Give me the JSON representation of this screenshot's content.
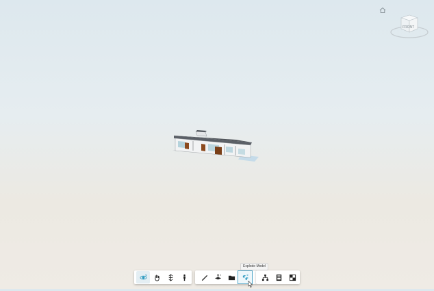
{
  "viewer": {
    "home_icon": "home-icon",
    "viewcube_label": "FRONT"
  },
  "tooltip": {
    "text": "Explode Model"
  },
  "toolbar": {
    "groups": [
      {
        "tools": [
          {
            "name": "orbit",
            "icon": "orbit-icon",
            "active": true
          },
          {
            "name": "pan",
            "icon": "hand-icon"
          },
          {
            "name": "zoom",
            "icon": "zoom-arrows-icon"
          },
          {
            "name": "first-person",
            "icon": "person-icon"
          }
        ]
      },
      {
        "tools": [
          {
            "name": "measure",
            "icon": "ruler-icon"
          },
          {
            "name": "section-analysis",
            "icon": "section-plane-icon"
          },
          {
            "name": "model-browser",
            "icon": "folder-icon"
          },
          {
            "name": "explode-model",
            "icon": "explode-cube-icon",
            "selected": true
          }
        ]
      },
      {
        "tools": [
          {
            "name": "structure",
            "icon": "hierarchy-icon"
          },
          {
            "name": "properties",
            "icon": "properties-icon"
          },
          {
            "name": "settings",
            "icon": "checker-icon"
          }
        ]
      }
    ]
  },
  "colors": {
    "accent": "#4aa3c6",
    "sky_top": "#dde8ee",
    "ground": "#efebe5"
  }
}
